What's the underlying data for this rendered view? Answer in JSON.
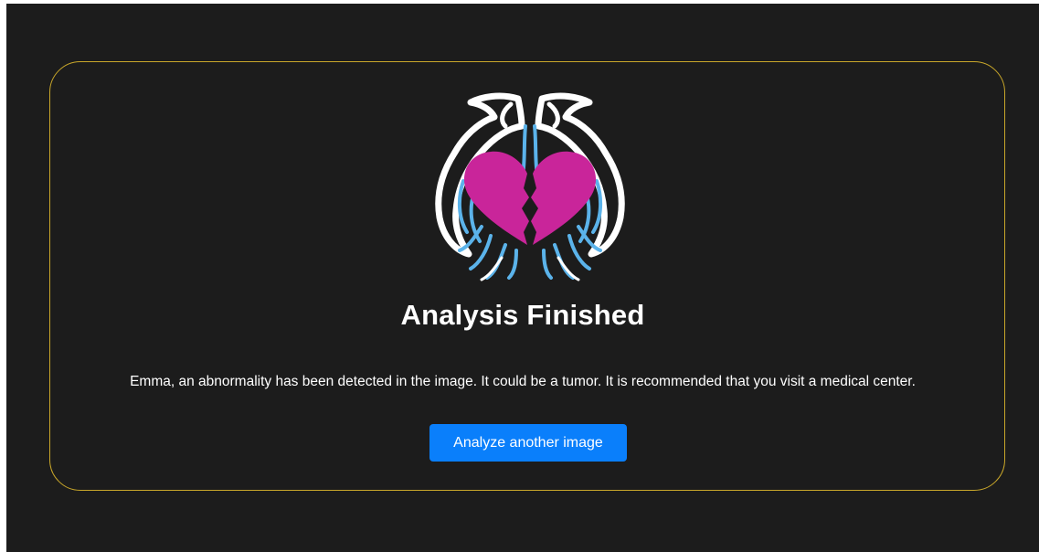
{
  "result": {
    "title": "Analysis Finished",
    "message": "Emma, an abnormality has been detected in the image. It could be a tumor. It is recommended that you visit a medical center.",
    "action_label": "Analyze another image"
  },
  "logo": {
    "icon": "heart-lungs-logo-icon",
    "colors": {
      "heart": "#c9259a",
      "lungs_outline": "#ffffff",
      "bronchi": "#5bb3ea"
    }
  },
  "colors": {
    "background": "#1c1c1c",
    "card_border": "#c9a72a",
    "button": "#0a7ffb",
    "text": "#ffffff"
  }
}
